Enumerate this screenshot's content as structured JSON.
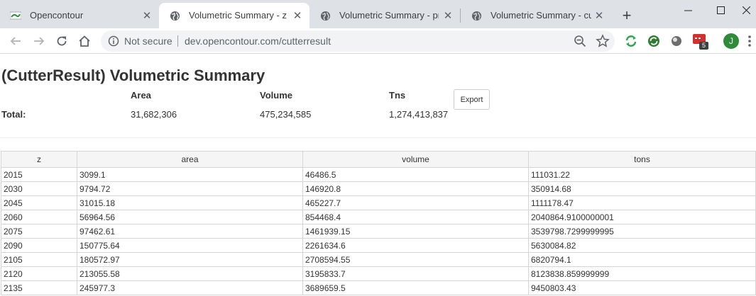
{
  "browser": {
    "tabs": [
      {
        "title": "Opencontour",
        "favicon": "opencontour-logo-icon",
        "active": false
      },
      {
        "title": "Volumetric Summary - z",
        "favicon": "globe-icon",
        "active": true
      },
      {
        "title": "Volumetric Summary - pn",
        "favicon": "globe-icon",
        "active": false
      },
      {
        "title": "Volumetric Summary - cut_f",
        "favicon": "globe-icon",
        "active": false
      }
    ],
    "security_label": "Not secure",
    "url": "dev.opencontour.com/cutterresult",
    "extension_badge": "5",
    "profile_initial": "J"
  },
  "page": {
    "title": "(CutterResult) Volumetric Summary",
    "summary": {
      "headers": [
        "Area",
        "Volume",
        "Tns"
      ],
      "total_label": "Total:",
      "values": [
        "31,682,306",
        "475,234,585",
        "1,274,413,837"
      ]
    },
    "export_label": "Export",
    "table": {
      "columns": [
        "z",
        "area",
        "volume",
        "tons"
      ],
      "rows": [
        [
          "2015",
          "3099.1",
          "46486.5",
          "111031.22"
        ],
        [
          "2030",
          "9794.72",
          "146920.8",
          "350914.68"
        ],
        [
          "2045",
          "31015.18",
          "465227.7",
          "1111178.47"
        ],
        [
          "2060",
          "56964.56",
          "854468.4",
          "2040864.9100000001"
        ],
        [
          "2075",
          "97462.61",
          "1461939.15",
          "3539798.7299999995"
        ],
        [
          "2090",
          "150775.64",
          "2261634.6",
          "5630084.82"
        ],
        [
          "2105",
          "180572.97",
          "2708594.55",
          "6820794.1"
        ],
        [
          "2120",
          "213055.58",
          "3195833.7",
          "8123838.859999999"
        ],
        [
          "2135",
          "245977.3",
          "3689659.5",
          "9450803.43"
        ]
      ]
    }
  }
}
